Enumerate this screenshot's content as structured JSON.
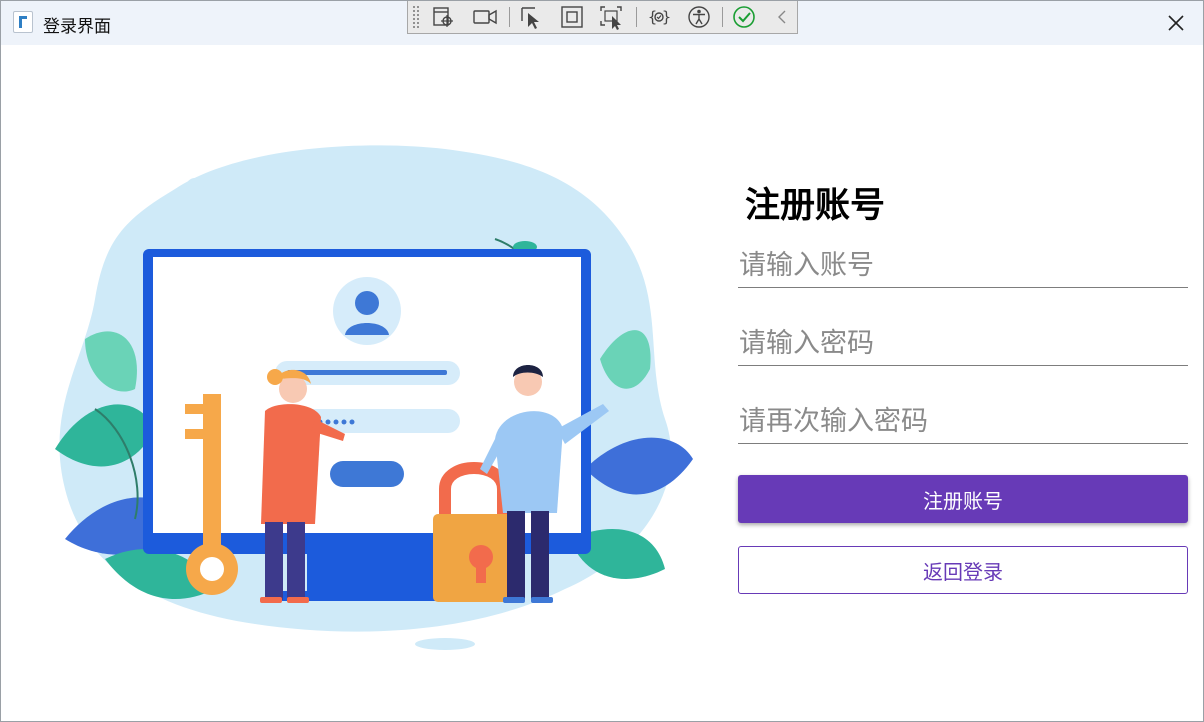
{
  "window": {
    "title": "登录界面",
    "app_icon": "app-logo-icon",
    "close_icon": "close-icon"
  },
  "debug_toolbar": {
    "tools": [
      "select-element-icon",
      "record-video-icon",
      "pointer-select-icon",
      "layout-bounds-icon",
      "select-with-pointer-icon",
      "binding-failures-icon",
      "accessibility-icon",
      "checkmark-icon",
      "collapse-chevron-icon"
    ]
  },
  "illustration": {
    "name": "login-illustration",
    "palette": {
      "blob": "#cfeaf8",
      "monitor": "#1c5bdc",
      "leaf_green": "#2fb59a",
      "leaf_blue": "#3e6fd9",
      "key": "#f6a84a",
      "lock": "#f0a543",
      "woman_shirt": "#f26b4c",
      "man_shirt": "#9cc8f4"
    }
  },
  "register_form": {
    "heading": "注册账号",
    "account_placeholder": "请输入账号",
    "password_placeholder": "请输入密码",
    "confirm_placeholder": "请再次输入密码",
    "register_button": "注册账号",
    "back_button": "返回登录"
  },
  "colors": {
    "accent": "#673ab7",
    "titlebar": "#eef3fa",
    "underline": "#7d7d7d"
  }
}
